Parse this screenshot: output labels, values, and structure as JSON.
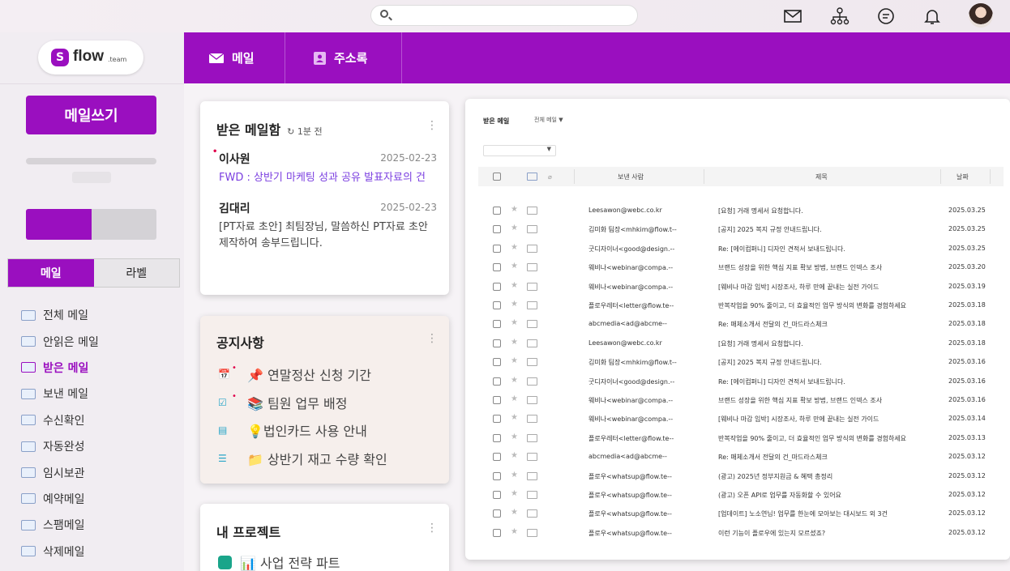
{
  "header": {
    "search_placeholder": ""
  },
  "nav": {
    "tabs": [
      {
        "label": "메일",
        "icon": "mail-icon"
      },
      {
        "label": "주소록",
        "icon": "address-book-icon"
      }
    ]
  },
  "sidebar": {
    "logo_text": "flow",
    "logo_sub": ".team",
    "compose_label": "메일쓰기",
    "usage_fraction": 0.5,
    "tabs": [
      {
        "label": "메일",
        "active": true
      },
      {
        "label": "라벨",
        "active": false
      }
    ],
    "folders": [
      {
        "label": "전체 메일",
        "icon": "all-mail-icon"
      },
      {
        "label": "안읽은 메일",
        "icon": "unread-mail-icon"
      },
      {
        "label": "받은 메일",
        "icon": "inbox-icon",
        "active": true
      },
      {
        "label": "보낸 메일",
        "icon": "sent-mail-icon"
      },
      {
        "label": "수신확인",
        "icon": "read-receipt-icon"
      },
      {
        "label": "자동완성",
        "icon": "autocomplete-icon"
      },
      {
        "label": "임시보관",
        "icon": "drafts-folder-icon"
      },
      {
        "label": "예약메일",
        "icon": "scheduled-mail-icon"
      },
      {
        "label": "스팸메일",
        "icon": "spam-mail-icon"
      },
      {
        "label": "삭제메일",
        "icon": "trash-mail-icon"
      }
    ]
  },
  "inbox_card": {
    "title": "받은 메일함",
    "refresh": "1분 전",
    "messages": [
      {
        "sender": "이사원",
        "date": "2025-02-23",
        "body": "FWD : 상반기 마케팅 성과 공유 발표자료의 건",
        "unread": true
      },
      {
        "sender": "김대리",
        "date": "2025-02-23",
        "body": "[PT자료 초안] 최팀장님, 말씀하신 PT자료 초안 제작하여 송부드립니다.",
        "unread": false
      }
    ]
  },
  "notice_card": {
    "title": "공지사항",
    "items": [
      {
        "text": "📌 연말정산 신청 기간",
        "icon": "calendar-icon",
        "new": true
      },
      {
        "text": "📚 팀원 업무 배정",
        "icon": "checkbox-icon",
        "new": true
      },
      {
        "text": "💡법인카드 사용 안내",
        "icon": "document-icon",
        "new": false
      },
      {
        "text": "📁 상반기 재고 수량 확인",
        "icon": "list-icon",
        "new": false
      }
    ]
  },
  "project_card": {
    "title": "내 프로젝트",
    "items": [
      {
        "text": "📊 사업 전략 파트",
        "color": "#1aa58a"
      }
    ]
  },
  "mail_list": {
    "title": "받은 메일",
    "filter": "전체 메일 ▼",
    "select_value": "▼",
    "columns": {
      "sender": "보낸 사람",
      "subject": "제목",
      "date": "날짜"
    },
    "rows": [
      {
        "sender": "Leesawon@webc.co.kr",
        "subject": "[요청] 거래 명세서 요청합니다.",
        "date": "2025.03.25"
      },
      {
        "sender": "김미화 팀장<mhkim@flow.t--",
        "subject": "[공지] 2025 복지 규정 안내드립니다.",
        "date": "2025.03.25"
      },
      {
        "sender": "굿디자이너<good@design.--",
        "subject": "Re: [에이컴퍼니] 디자인 견적서 보내드립니다.",
        "date": "2025.03.25"
      },
      {
        "sender": "웨비나<webinar@compa.--",
        "subject": "브랜드 성장을 위한 핵심 지표 확보 방법, 브랜드 인덱스 조사",
        "date": "2025.03.20"
      },
      {
        "sender": "웨비나<webinar@compa.--",
        "subject": "[웨비나 마감 임박] 시장조사, 하루 만에 끝내는 실전 가이드",
        "date": "2025.03.19"
      },
      {
        "sender": "플로우레터<letter@flow.te--",
        "subject": "반복작업을 90% 줄이고, 더 효율적인 업무 방식의 변화를 경험하세요",
        "date": "2025.03.18"
      },
      {
        "sender": "abcmedia<ad@abcme--",
        "subject": "Re: 매체소개서 전달의 건_마드라스체크",
        "date": "2025.03.18"
      },
      {
        "sender": "Leesawon@webc.co.kr",
        "subject": "[요청] 거래 명세서 요청합니다.",
        "date": "2025.03.18"
      },
      {
        "sender": "김미화 팀장<mhkim@flow.t--",
        "subject": "[공지] 2025 복지 규정 안내드립니다.",
        "date": "2025.03.16"
      },
      {
        "sender": "굿디자이너<good@design.--",
        "subject": "Re: [에이컴퍼니] 디자인 견적서 보내드립니다.",
        "date": "2025.03.16"
      },
      {
        "sender": "웨비나<webinar@compa.--",
        "subject": "브랜드 성장을 위한 핵심 지표 확보 방법, 브랜드 인덱스 조사",
        "date": "2025.03.16"
      },
      {
        "sender": "웨비나<webinar@compa.--",
        "subject": "[웨비나 마감 임박] 시장조사, 하루 만에 끝내는 실전 가이드",
        "date": "2025.03.14"
      },
      {
        "sender": "플로우레터<letter@flow.te--",
        "subject": "반복작업을 90% 줄이고, 더 효율적인 업무 방식의 변화를 경험하세요",
        "date": "2025.03.13"
      },
      {
        "sender": "abcmedia<ad@abcme--",
        "subject": "Re: 매체소개서 전달의 건_마드라스체크",
        "date": "2025.03.12"
      },
      {
        "sender": "플로우<whatsup@flow.te--",
        "subject": "(광고) 2025년 정부지원금 & 혜택 총정리",
        "date": "2025.03.12"
      },
      {
        "sender": "플로우<whatsup@flow.te--",
        "subject": "(광고) 오픈 API로 업무를 자동화할 수 있어요",
        "date": "2025.03.12"
      },
      {
        "sender": "플로우<whatsup@flow.te--",
        "subject": "[업데이트] 노소연님! 업무를 한눈에 모아보는 대시보드 외 3건",
        "date": "2025.03.12"
      },
      {
        "sender": "플로우<whatsup@flow.te--",
        "subject": "이런 기능이 플로우에 있는지 모르셨죠?",
        "date": "2025.03.12"
      }
    ]
  },
  "colors": {
    "brand": "#9a0fbf"
  }
}
